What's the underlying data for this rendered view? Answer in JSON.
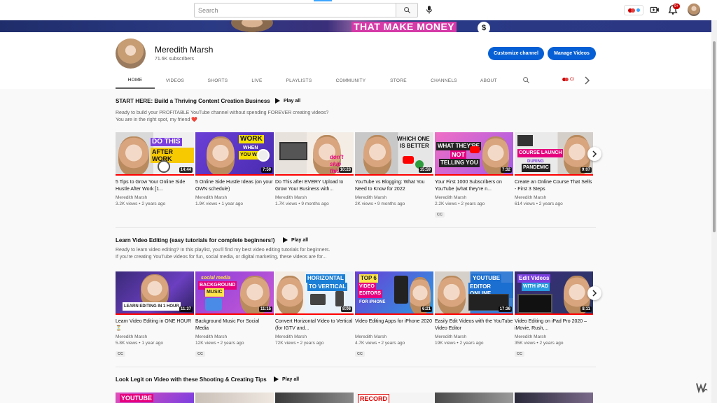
{
  "masthead": {
    "search_placeholder": "Search",
    "notification_count": "9+"
  },
  "banner": {
    "text": "THAT MAKE MONEY",
    "coin": "$"
  },
  "channel": {
    "name": "Meredith Marsh",
    "subscribers": "71.6K subscribers",
    "customize_label": "Customize channel",
    "manage_label": "Manage Videos"
  },
  "tabs": [
    "HOME",
    "VIDEOS",
    "SHORTS",
    "LIVE",
    "PLAYLISTS",
    "COMMUNITY",
    "STORE",
    "CHANNELS",
    "ABOUT"
  ],
  "tab_extra": "CI",
  "sections": [
    {
      "title": "START HERE: Build a Thriving Content Creation Business",
      "play_all": "Play all",
      "desc1": "Ready to build your PROFITABLE YouTube channel without spending FOREVER creating videos?",
      "desc2": "You are in the right spot, my friend ❤️",
      "videos": [
        {
          "title": "5 Tips to Grow Your Online Side Hustle After Work [1...",
          "channel": "Meredith Marsh",
          "meta": "3.2K views • 2 years ago",
          "duration": "14:44",
          "caption": "DO THIS AFTER WORK",
          "cc": ""
        },
        {
          "title": "5 Online Side Hustle Ideas (on your OWN schedule)",
          "channel": "Meredith Marsh",
          "meta": "1.9K views • 1 year ago",
          "duration": "7:50",
          "caption": "WORK WHEN YOU WANT",
          "cc": ""
        },
        {
          "title": "Do This after EVERY Upload to Grow Your Business with...",
          "channel": "Meredith Marsh",
          "meta": "1.7K views • 9 months ago",
          "duration": "10:23",
          "caption": "don't skip this",
          "cc": ""
        },
        {
          "title": "YouTube vs Blogging: What You Need to Know for 2022",
          "channel": "Meredith Marsh",
          "meta": "2K views • 9 months ago",
          "duration": "15:59",
          "caption": "WHICH ONE IS BETTER",
          "cc": ""
        },
        {
          "title": "Your First 1000 Subscribers on YouTube (what they're n...",
          "channel": "Meredith Marsh",
          "meta": "2.2K views • 2 years ago",
          "duration": "7:32",
          "caption": "WHAT THEY'RE NOT TELLING YOU",
          "cc": "CC"
        },
        {
          "title": "Create an Online Course That Sells - First 3 Steps",
          "channel": "Meredith Marsh",
          "meta": "614 views • 2 years ago",
          "duration": "9:07",
          "caption": "COURSE LAUNCH DURING PANDEMIC",
          "cc": ""
        }
      ]
    },
    {
      "title": "Learn Video Editing (easy tutorials for complete beginners!)",
      "play_all": "Play all",
      "desc1": "Ready to learn video editing? In this playlist, you'll find my best video editing tutorials for beginners.",
      "desc2": "If you're creating YouTube videos for fun, social media, or digital marketing, these videos are for...",
      "videos": [
        {
          "title": "Learn Video Editing in ONE HOUR ⏳",
          "channel": "Meredith Marsh",
          "meta": "5.8K views • 1 year ago",
          "duration": "11:37",
          "caption": "LEARN EDITING IN 1 HOUR",
          "cc": "CC"
        },
        {
          "title": "Background Music For Social Media",
          "channel": "Meredith Marsh",
          "meta": "12K views • 2 years ago",
          "duration": "11:15",
          "caption": "social media BACKGROUND MUSIC",
          "cc": "CC"
        },
        {
          "title": "Convert Horizontal Video to Vertical (for IGTV and...",
          "channel": "Meredith Marsh",
          "meta": "72K views • 2 years ago",
          "duration": "8:06",
          "caption": "HORIZONTAL TO VERTICAL",
          "cc": ""
        },
        {
          "title": "Video Editing Apps for iPhone 2020",
          "channel": "Meredith Marsh",
          "meta": "4.7K views • 2 years ago",
          "duration": "6:21",
          "caption": "TOP 6 VIDEO EDITORS FOR iPHONE",
          "cc": "CC"
        },
        {
          "title": "Easily Edit Videos with the YouTube Video Editor",
          "channel": "Meredith Marsh",
          "meta": "19K views • 2 years ago",
          "duration": "17:36",
          "caption": "YOUTUBE EDITOR ONLINE",
          "cc": ""
        },
        {
          "title": "Video Editing on iPad Pro 2020 – iMovie, Rush,...",
          "channel": "Meredith Marsh",
          "meta": "35K views • 2 years ago",
          "duration": "8:11",
          "caption": "Edit Videos WITH iPAD",
          "cc": "CC"
        }
      ]
    },
    {
      "title": "Look Legit on Video with these Shooting & Creating Tips",
      "play_all": "Play all",
      "thumb_captions": [
        "YOUTUBE",
        "RECORD"
      ]
    }
  ],
  "colors": {
    "accent": "#065fd4",
    "progress": "#ff0000",
    "bell_badge": "#cc0000"
  }
}
